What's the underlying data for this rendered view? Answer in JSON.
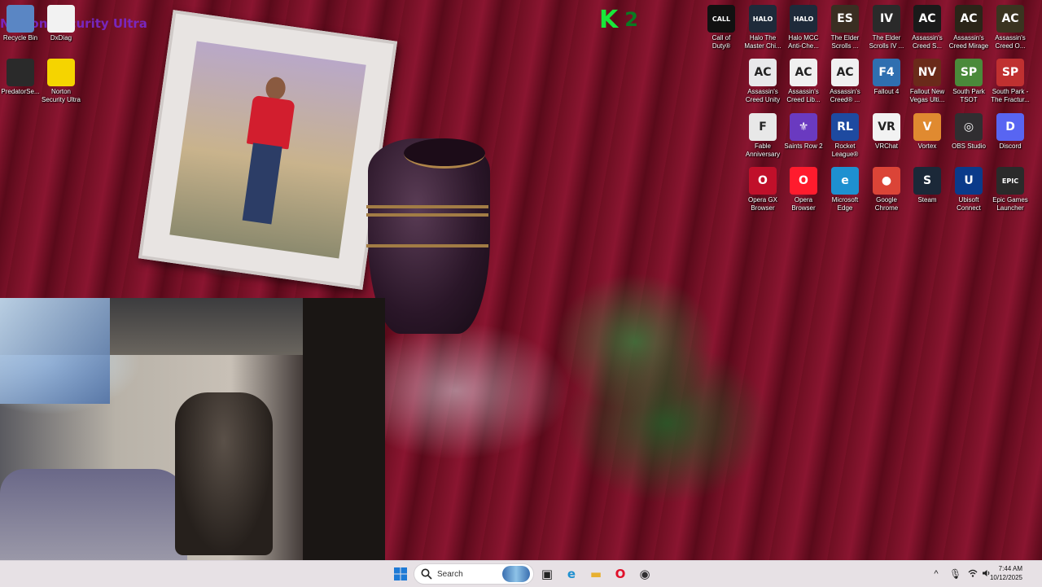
{
  "desktop": {
    "left_icons": [
      {
        "label": "Recycle Bin",
        "icon": "recycle-bin-icon",
        "color": "#5a86c4"
      },
      {
        "label": "DxDiag",
        "icon": "document-icon",
        "color": "#f2f2f2"
      },
      {
        "label": "PredatorSe...",
        "icon": "predator-sense-icon",
        "color": "#2a2a2a"
      },
      {
        "label": "Norton\nSecurity Ultra",
        "icon": "norton-icon",
        "color": "#f5d400"
      }
    ],
    "right_icons": [
      {
        "label": "Call of\nDuty®",
        "icon": "call-of-duty-icon",
        "glyph": "CALL\nDUTY",
        "color": "#111111"
      },
      {
        "label": "Halo The\nMaster Chi...",
        "icon": "halo-mcc-icon",
        "glyph": "HALO",
        "color": "#1e2a3a"
      },
      {
        "label": "Halo MCC\nAnti-Che...",
        "icon": "halo-anticheat-icon",
        "glyph": "HALO",
        "color": "#1e2a3a"
      },
      {
        "label": "The Elder\nScrolls ...",
        "icon": "elder-scrolls-icon",
        "glyph": "ES",
        "color": "#3a2e22"
      },
      {
        "label": "The Elder\nScrolls IV ...",
        "icon": "oblivion-icon",
        "glyph": "IV",
        "color": "#2a2a2a"
      },
      {
        "label": "Assassin's\nCreed S...",
        "icon": "assassins-creed-shadows-icon",
        "glyph": "AC",
        "color": "#1a1a1a"
      },
      {
        "label": "Assassin's\nCreed Mirage",
        "icon": "assassins-creed-mirage-icon",
        "glyph": "AC",
        "color": "#2a2418"
      },
      {
        "label": "Assassin's\nCreed O...",
        "icon": "assassins-creed-origins-icon",
        "glyph": "AC",
        "color": "#3a3420"
      },
      {
        "label": "Assassin's\nCreed Unity",
        "icon": "assassins-creed-unity-icon",
        "glyph": "AC",
        "color": "#e8e8ea"
      },
      {
        "label": "Assassin's\nCreed Lib...",
        "icon": "assassins-creed-liberation-icon",
        "glyph": "AC",
        "color": "#f0f0f0"
      },
      {
        "label": "Assassin's\nCreed® ...",
        "icon": "assassins-creed-icon",
        "glyph": "AC",
        "color": "#f0f0f0"
      },
      {
        "label": "Fallout 4",
        "icon": "fallout4-icon",
        "glyph": "F4",
        "color": "#2f6fb0"
      },
      {
        "label": "Fallout New\nVegas Ulti...",
        "icon": "fallout-nv-icon",
        "glyph": "NV",
        "color": "#6a2a1a"
      },
      {
        "label": "South Park\nTSOT",
        "icon": "south-park-tsot-icon",
        "glyph": "SP",
        "color": "#4a8a3a"
      },
      {
        "label": "South Park -\nThe Fractur...",
        "icon": "south-park-fbw-icon",
        "glyph": "SP",
        "color": "#c03030"
      },
      {
        "label": "Fable\nAnniversary",
        "icon": "fable-icon",
        "glyph": "F",
        "color": "#e8e8e8"
      },
      {
        "label": "Saints Row 2",
        "icon": "saints-row-icon",
        "glyph": "⚜",
        "color": "#6a3ac0"
      },
      {
        "label": "Rocket\nLeague®",
        "icon": "rocket-league-icon",
        "glyph": "RL",
        "color": "#1e4aa0"
      },
      {
        "label": "VRChat",
        "icon": "vrchat-icon",
        "glyph": "VR",
        "color": "#f2f2f2"
      },
      {
        "label": "Vortex",
        "icon": "vortex-icon",
        "glyph": "V",
        "color": "#e08a30"
      },
      {
        "label": "OBS Studio",
        "icon": "obs-icon",
        "glyph": "◎",
        "color": "#302e31"
      },
      {
        "label": "Discord",
        "icon": "discord-icon",
        "glyph": "D",
        "color": "#5865f2"
      },
      {
        "label": "Opera GX\nBrowser",
        "icon": "opera-gx-icon",
        "glyph": "O",
        "color": "#c0102a"
      },
      {
        "label": "Opera\nBrowser",
        "icon": "opera-icon",
        "glyph": "O",
        "color": "#ff1b2d"
      },
      {
        "label": "Microsoft\nEdge",
        "icon": "edge-icon",
        "glyph": "e",
        "color": "#1e90d0"
      },
      {
        "label": "Google\nChrome",
        "icon": "chrome-icon",
        "glyph": "●",
        "color": "#db4437"
      },
      {
        "label": "Steam",
        "icon": "steam-icon",
        "glyph": "S",
        "color": "#1b2838"
      },
      {
        "label": "Ubisoft\nConnect",
        "icon": "ubisoft-icon",
        "glyph": "U",
        "color": "#0a3a8a"
      },
      {
        "label": "Epic Games\nLauncher",
        "icon": "epic-games-icon",
        "glyph": "EPIC",
        "color": "#2a2a2a"
      }
    ],
    "overlay": {
      "k": "K",
      "num": "2"
    },
    "watermark": "Norton Security Ultra"
  },
  "taskbar": {
    "search_placeholder": "Search",
    "apps": [
      {
        "icon": "task-view-icon",
        "glyph": "▣",
        "color": "#222222"
      },
      {
        "icon": "edge-taskbar-icon",
        "glyph": "e",
        "color": "#1e90d0"
      },
      {
        "icon": "file-explorer-icon",
        "glyph": "▬",
        "color": "#e8b030"
      },
      {
        "icon": "opera-taskbar-icon",
        "glyph": "O",
        "color": "#e0102a"
      },
      {
        "icon": "obs-taskbar-icon",
        "glyph": "◉",
        "color": "#302e31"
      }
    ],
    "tray": {
      "chevron": "^",
      "time": "7:44 AM",
      "date": "10/12/2025"
    }
  }
}
